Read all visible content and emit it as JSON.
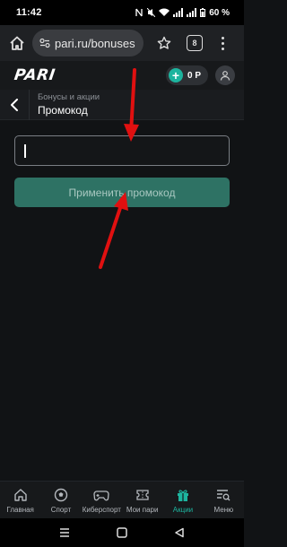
{
  "status_bar": {
    "time": "11:42",
    "battery": "60 %"
  },
  "browser": {
    "url": "pari.ru/bonuses",
    "tab_count": "8"
  },
  "header": {
    "logo": "PARI",
    "balance": "0 Р"
  },
  "breadcrumb": {
    "section": "Бонусы и акции",
    "title": "Промокод"
  },
  "promo": {
    "input_value": "",
    "apply_label": "Применить промокод"
  },
  "bottom_nav": {
    "items": [
      {
        "label": "Главная",
        "icon": "home-icon"
      },
      {
        "label": "Спорт",
        "icon": "soccer-ball-icon"
      },
      {
        "label": "Киберспорт",
        "icon": "gamepad-icon"
      },
      {
        "label": "Мои пари",
        "icon": "ticket-icon"
      },
      {
        "label": "Акции",
        "icon": "gift-icon"
      },
      {
        "label": "Меню",
        "icon": "menu-search-icon"
      }
    ],
    "active_index": 4
  },
  "colors": {
    "accent": "#1db49e",
    "button_bg": "#2e7264",
    "arrow": "#e01010"
  }
}
